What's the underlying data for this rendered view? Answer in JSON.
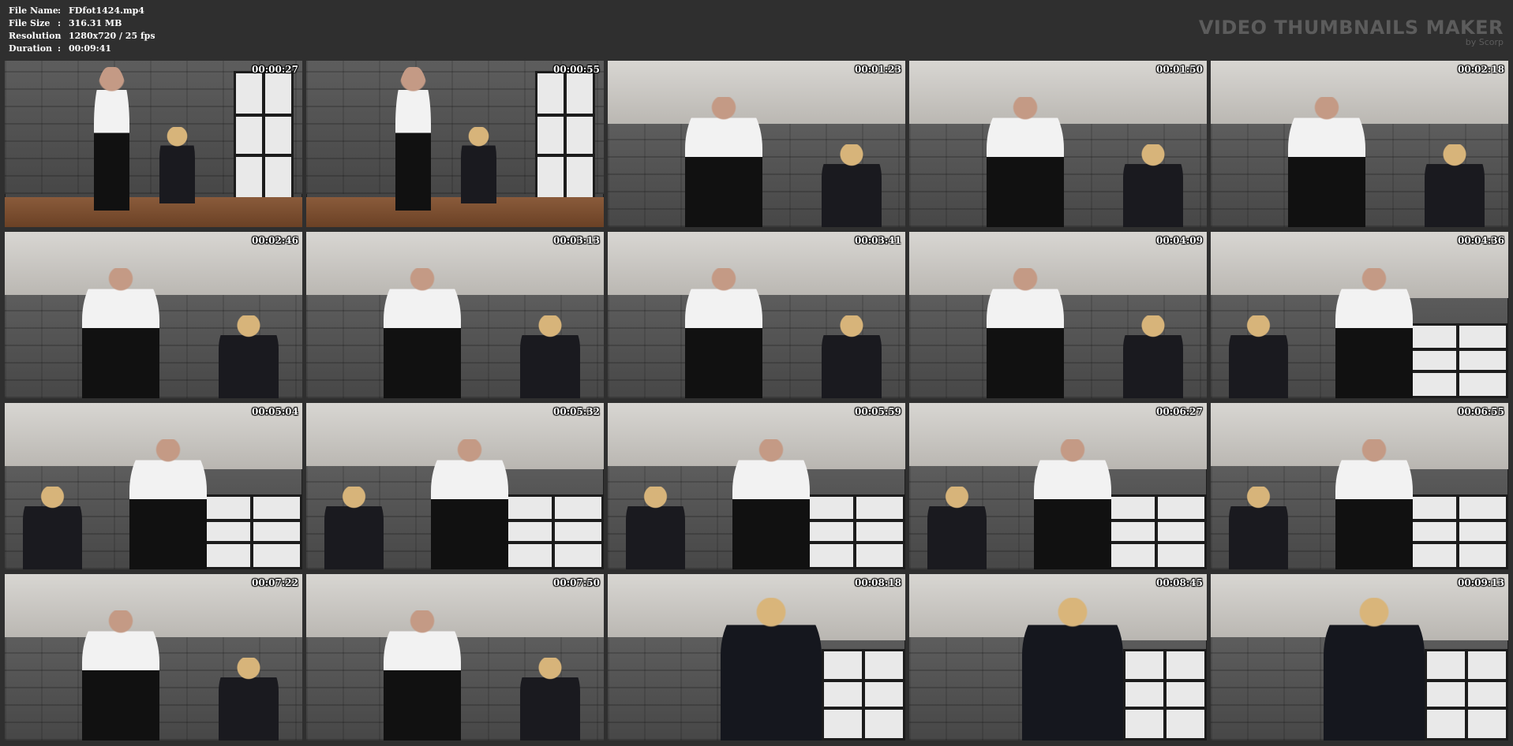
{
  "meta": {
    "file_name_label": "File Name",
    "file_name": "FDfot1424.mp4",
    "file_size_label": "File Size",
    "file_size": "316.31 MB",
    "resolution_label": "Resolution",
    "resolution": "1280x720 / 25 fps",
    "duration_label": "Duration",
    "duration": "00:09:41",
    "separator": ":"
  },
  "brand": {
    "title": "VIDEO THUMBNAILS MAKER",
    "subtitle": "by Scorp"
  },
  "thumbnails": [
    {
      "time": "00:00:27",
      "scene": "wide-room"
    },
    {
      "time": "00:00:55",
      "scene": "wide-room"
    },
    {
      "time": "00:01:23",
      "scene": "low-angle-a"
    },
    {
      "time": "00:01:50",
      "scene": "low-angle-a"
    },
    {
      "time": "00:02:18",
      "scene": "low-angle-a"
    },
    {
      "time": "00:02:46",
      "scene": "low-angle-a"
    },
    {
      "time": "00:03:13",
      "scene": "low-angle-a"
    },
    {
      "time": "00:03:41",
      "scene": "low-angle-a"
    },
    {
      "time": "00:04:09",
      "scene": "low-angle-a"
    },
    {
      "time": "00:04:36",
      "scene": "low-angle-window"
    },
    {
      "time": "00:05:04",
      "scene": "low-angle-window"
    },
    {
      "time": "00:05:32",
      "scene": "low-angle-window"
    },
    {
      "time": "00:05:59",
      "scene": "low-angle-window"
    },
    {
      "time": "00:06:27",
      "scene": "low-angle-window"
    },
    {
      "time": "00:06:55",
      "scene": "low-angle-window"
    },
    {
      "time": "00:07:22",
      "scene": "low-angle-a"
    },
    {
      "time": "00:07:50",
      "scene": "low-angle-a"
    },
    {
      "time": "00:08:18",
      "scene": "low-angle-dress"
    },
    {
      "time": "00:08:45",
      "scene": "low-angle-dress"
    },
    {
      "time": "00:09:13",
      "scene": "low-angle-dress"
    }
  ]
}
